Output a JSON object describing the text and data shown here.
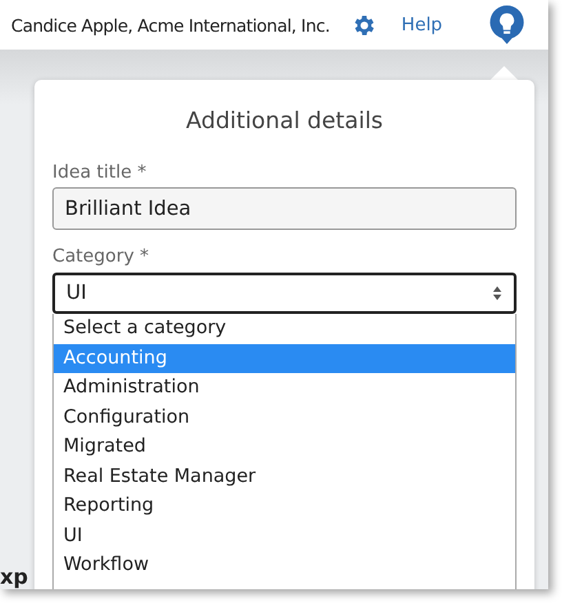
{
  "header": {
    "user": "Candice Apple, Acme International, Inc.",
    "help_link": "Help"
  },
  "background": {
    "partial_text": "xp"
  },
  "popover": {
    "title": "Additional details",
    "idea_title": {
      "label": "Idea title *",
      "value": "Brilliant Idea"
    },
    "category": {
      "label": "Category *",
      "value": "UI",
      "options": [
        {
          "label": "Select a category",
          "highlighted": false
        },
        {
          "label": "Accounting",
          "highlighted": true
        },
        {
          "label": "Administration",
          "highlighted": false
        },
        {
          "label": "Configuration",
          "highlighted": false
        },
        {
          "label": "Migrated",
          "highlighted": false
        },
        {
          "label": "Real Estate Manager",
          "highlighted": false
        },
        {
          "label": "Reporting",
          "highlighted": false
        },
        {
          "label": "UI",
          "highlighted": false
        },
        {
          "label": "Workflow",
          "highlighted": false
        }
      ]
    }
  }
}
